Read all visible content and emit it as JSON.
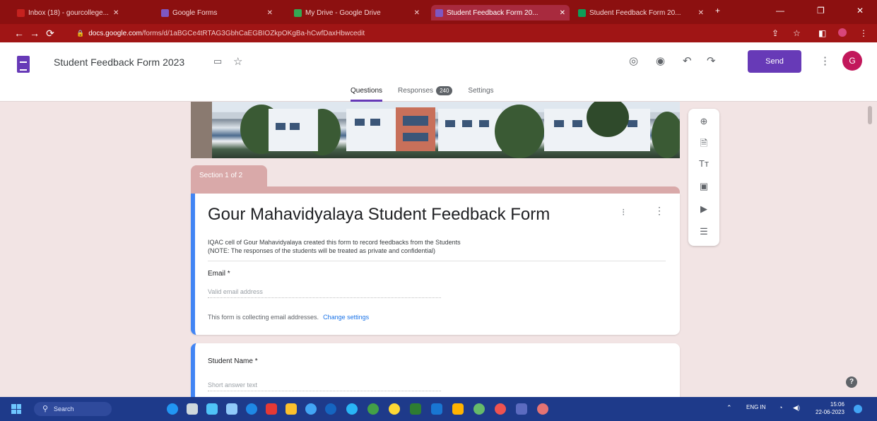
{
  "browser": {
    "tabs": [
      {
        "label": "Inbox (18) - gourcollege...",
        "fav": "#c5221f",
        "active": false
      },
      {
        "label": "Google Forms",
        "fav": "#7e57c2",
        "active": false
      },
      {
        "label": "My Drive - Google Drive",
        "fav": "#34a853",
        "active": false
      },
      {
        "label": "Student Feedback Form 20...",
        "fav": "#7e57c2",
        "active": true
      },
      {
        "label": "Student Feedback Form 20...",
        "fav": "#0f9d58",
        "active": false
      }
    ],
    "url_domain": "docs.google.com",
    "url_path": "/forms/d/1aBGCe4tRTAG3GbhCaEGBIOZkpOKgBa-hCwfDaxHbwcedit"
  },
  "header": {
    "doc_title": "Student Feedback Form 2023",
    "send_label": "Send",
    "avatar_letter": "G",
    "tabs": {
      "questions": "Questions",
      "responses": "Responses",
      "responses_count": "240",
      "settings": "Settings"
    }
  },
  "form": {
    "section_label": "Section 1 of 2",
    "title": "Gour Mahavidyalaya Student Feedback Form",
    "description_line1": "IQAC cell of Gour Mahavidyalaya created this form to record feedbacks from the Students",
    "description_line2": "(NOTE: The responses of the students will be treated as private and confidential)",
    "email_label": "Email *",
    "email_placeholder": "Valid email address",
    "collect_note": "This form is collecting email addresses.",
    "change_settings": "Change settings",
    "q2_label": "Student Name *",
    "q2_placeholder": "Short answer text"
  },
  "sidetools": [
    "add-question-icon",
    "import-questions-icon",
    "add-title-icon",
    "add-image-icon",
    "add-video-icon",
    "add-section-icon"
  ],
  "taskbar": {
    "search_label": "Search",
    "tray_text": "ENG IN",
    "time": "15:06",
    "date": "22-06-2023"
  },
  "colors": {
    "accent": "#673ab7",
    "browser_frame": "#8c1010",
    "card_border": "#4285f4",
    "section_tab": "#d9a9a9"
  }
}
